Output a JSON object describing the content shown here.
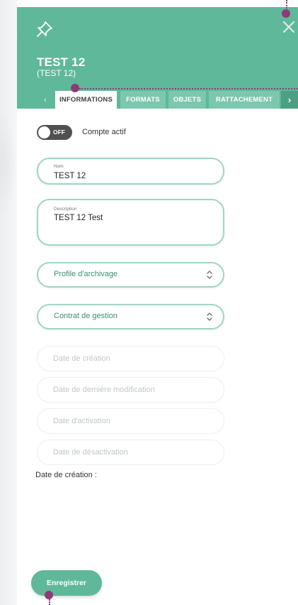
{
  "header": {
    "title": "TEST 12",
    "subtitle": "(TEST 12)",
    "pin_icon": "pin-icon",
    "close_icon": "close-icon"
  },
  "tabs": [
    {
      "label": "INFORMATIONS",
      "active": true
    },
    {
      "label": "FORMATS",
      "active": false
    },
    {
      "label": "OBJETS",
      "active": false
    },
    {
      "label": "RATTACHEMENT",
      "active": false
    }
  ],
  "tab_nav": {
    "prev": "‹",
    "next": "›"
  },
  "toggle": {
    "state": "OFF",
    "label": "Compte actif"
  },
  "fields": {
    "nom": {
      "label": "Nom",
      "value": "TEST 12"
    },
    "description": {
      "label": "Description",
      "value": "TEST 12 Test"
    },
    "profile": {
      "placeholder": "Profile d'archivage"
    },
    "contrat": {
      "placeholder": "Contrat de gestion"
    },
    "date_creation": {
      "placeholder": "Date de création"
    },
    "date_modif": {
      "placeholder": "Date de dernière modification"
    },
    "date_activation": {
      "placeholder": "Date d'activation"
    },
    "date_desactivation": {
      "placeholder": "Date de désactivation"
    }
  },
  "date_creation_label": "Date de création :",
  "save_label": "Enregistrer",
  "colors": {
    "accent": "#5fb89a",
    "accent_light": "#7cc7ae",
    "annotation": "#8e3a78"
  }
}
